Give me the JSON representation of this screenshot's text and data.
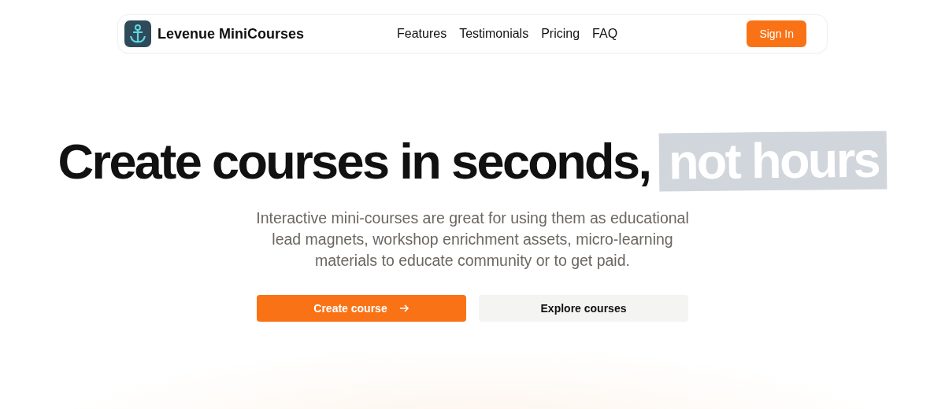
{
  "navbar": {
    "brand": "Levenue MiniCourses",
    "links": [
      "Features",
      "Testimonials",
      "Pricing",
      "FAQ"
    ],
    "sign_in": "Sign In"
  },
  "hero": {
    "headline": "Create courses in seconds,",
    "headline_highlight": "not hours",
    "description": "Interactive mini-courses are great for using them as educational lead magnets, workshop enrichment assets, micro-learning materials to educate community or to get paid.",
    "primary_button": "Create course",
    "secondary_button": "Explore courses"
  }
}
